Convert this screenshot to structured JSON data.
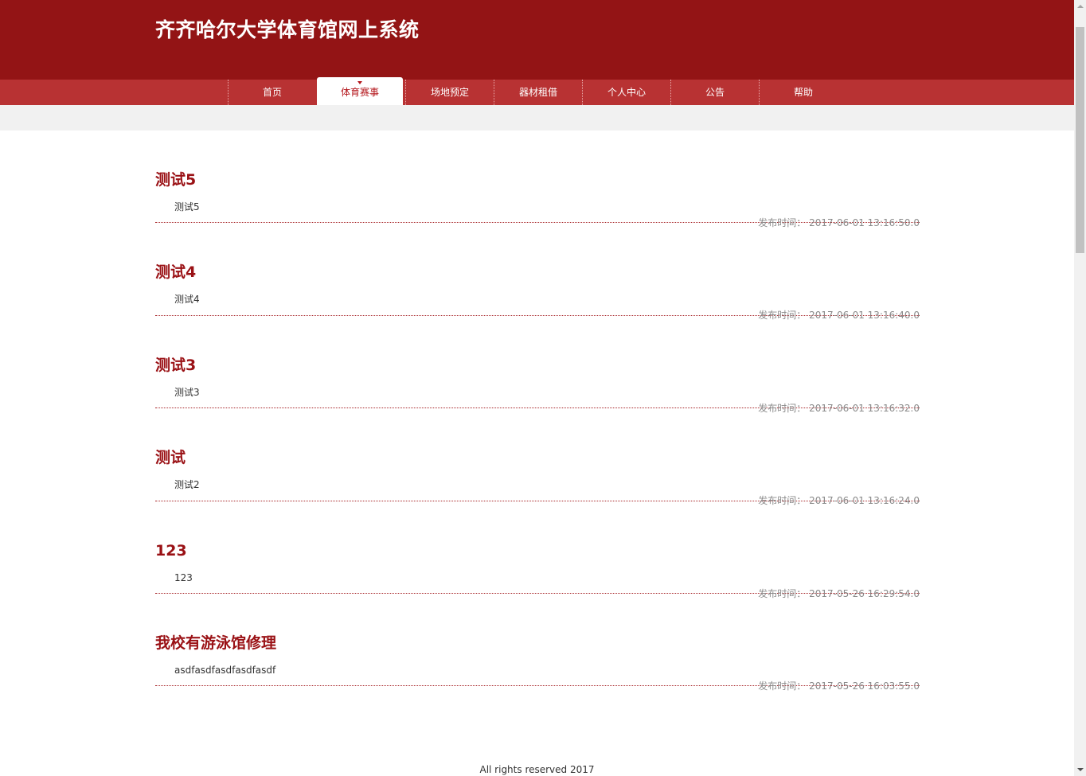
{
  "header": {
    "title": "齐齐哈尔大学体育馆网上系统"
  },
  "nav": {
    "items": [
      {
        "label": "首页",
        "active": false
      },
      {
        "label": "体育赛事",
        "active": true
      },
      {
        "label": "场地预定",
        "active": false
      },
      {
        "label": "器材租借",
        "active": false
      },
      {
        "label": "个人中心",
        "active": false
      },
      {
        "label": "公告",
        "active": false
      },
      {
        "label": "帮助",
        "active": false
      }
    ]
  },
  "posts": [
    {
      "title": "测试5",
      "body": "测试5",
      "time_label": "发布时间：",
      "time": "2017-06-01 13:16:50.0"
    },
    {
      "title": "测试4",
      "body": "测试4",
      "time_label": "发布时间：",
      "time": "2017-06-01 13:16:40.0"
    },
    {
      "title": "测试3",
      "body": "测试3",
      "time_label": "发布时间：",
      "time": "2017-06-01 13:16:32.0"
    },
    {
      "title": "测试",
      "body": "测试2",
      "time_label": "发布时间：",
      "time": "2017-06-01 13:16:24.0"
    },
    {
      "title": "123",
      "body": "123",
      "time_label": "发布时间：",
      "time": "2017-05-26 16:29:54.0"
    },
    {
      "title": "我校有游泳馆修理",
      "body": "asdfasdfasdfasdfasdf",
      "time_label": "发布时间：",
      "time": "2017-05-26 16:03:55.0"
    }
  ],
  "footer": {
    "text": "All rights reserved 2017"
  },
  "colors": {
    "header_bg": "#931415",
    "nav_bg": "#b83233",
    "accent": "#9a1115"
  }
}
